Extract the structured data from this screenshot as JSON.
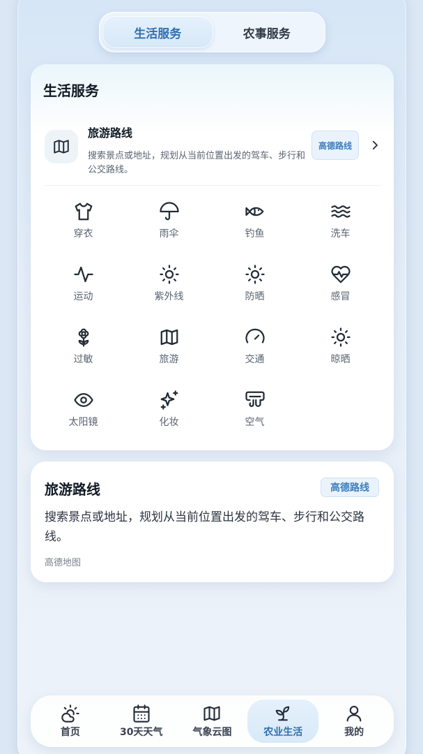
{
  "segment": {
    "tabs": [
      "生活服务",
      "农事服务"
    ],
    "active": 0
  },
  "card1": {
    "title": "生活服务",
    "route": {
      "icon": "map-icon",
      "title": "旅游路线",
      "desc": "搜索景点或地址，规划从当前位置出发的驾车、步行和公交路线。",
      "badge": "高德路线"
    },
    "grid": [
      {
        "icon": "shirt-icon",
        "label": "穿衣"
      },
      {
        "icon": "umbrella-icon",
        "label": "雨伞"
      },
      {
        "icon": "fish-icon",
        "label": "钓鱼"
      },
      {
        "icon": "waves-icon",
        "label": "洗车"
      },
      {
        "icon": "activity-icon",
        "label": "运动"
      },
      {
        "icon": "sun-icon",
        "label": "紫外线"
      },
      {
        "icon": "sun-icon",
        "label": "防晒"
      },
      {
        "icon": "heart-pulse-icon",
        "label": "感冒"
      },
      {
        "icon": "flower-icon",
        "label": "过敏"
      },
      {
        "icon": "map-icon",
        "label": "旅游"
      },
      {
        "icon": "gauge-icon",
        "label": "交通"
      },
      {
        "icon": "sun-icon",
        "label": "晾晒"
      },
      {
        "icon": "eye-icon",
        "label": "太阳镜"
      },
      {
        "icon": "sparkles-icon",
        "label": "化妆"
      },
      {
        "icon": "air-vent-icon",
        "label": "空气"
      }
    ]
  },
  "card2": {
    "title": "旅游路线",
    "badge": "高德路线",
    "desc": "搜索景点或地址，规划从当前位置出发的驾车、步行和公交路线。",
    "source": "高德地图"
  },
  "tabbar": {
    "items": [
      {
        "icon": "cloud-sun-icon",
        "label": "首页"
      },
      {
        "icon": "calendar-icon",
        "label": "30天天气"
      },
      {
        "icon": "map-icon",
        "label": "气象云图"
      },
      {
        "icon": "sprout-icon",
        "label": "农业生活"
      },
      {
        "icon": "user-icon",
        "label": "我的"
      }
    ],
    "active": 3
  },
  "colors": {
    "accent": "#2f6fb0",
    "badge_bg": "#eaf3fb"
  }
}
